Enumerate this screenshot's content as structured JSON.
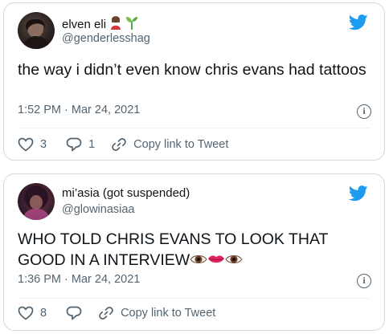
{
  "tweets": [
    {
      "display_name": "elven eli",
      "name_emoji": [
        "person-icon",
        "seedling-icon"
      ],
      "handle": "@genderlesshag",
      "text": "the way i didn’t even know chris evans had tattoos",
      "timestamp": "1:52 PM · Mar 24, 2021",
      "likes": "3",
      "replies": "1",
      "copy_link_label": "Copy link to Tweet"
    },
    {
      "display_name": "mi’asia (got suspended)",
      "handle": "@glowinasiaa",
      "text": "WHO TOLD CHRIS EVANS TO LOOK THAT GOOD IN A INTERVIEW",
      "text_emoji": [
        "eye-icon",
        "lips-icon",
        "eye-icon"
      ],
      "timestamp": "1:36 PM · Mar 24, 2021",
      "likes": "8",
      "copy_link_label": "Copy link to Tweet"
    }
  ],
  "colors": {
    "text": "#0f1419",
    "secondary": "#536471",
    "border": "#cfd9de",
    "twitter_blue": "#1d9bf0"
  }
}
